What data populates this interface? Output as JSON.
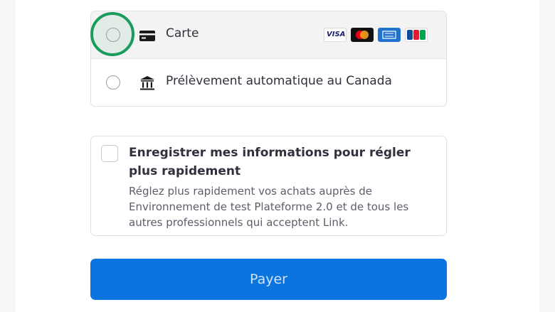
{
  "payment_methods": [
    {
      "label": "Carte",
      "icon": "credit-card-icon",
      "selected": false,
      "brands": [
        "VISA",
        "Mastercard",
        "American Express",
        "JCB"
      ]
    },
    {
      "label": "Prélèvement automatique au Canada",
      "icon": "bank-icon",
      "selected": false
    }
  ],
  "save_info": {
    "title": "Enregistrer mes informations pour régler plus rapidement",
    "description": "Réglez plus rapidement vos achats auprès de Environnement de test Plateforme 2.0 et de tous les autres professionnels qui acceptent Link.",
    "checked": false
  },
  "pay_button": {
    "label": "Payer"
  },
  "colors": {
    "accent": "#0b74de",
    "focus": "#1a9d5c"
  }
}
